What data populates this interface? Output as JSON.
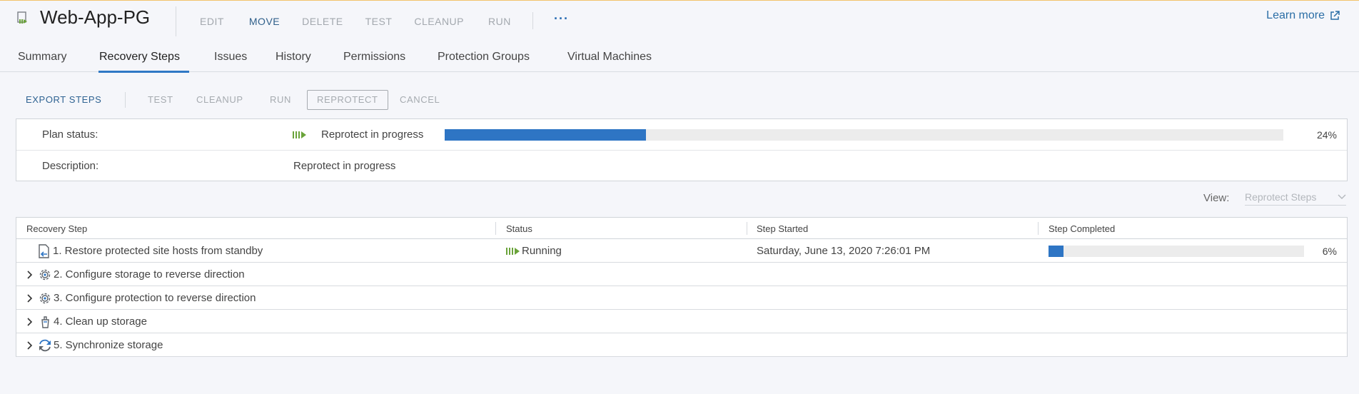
{
  "header": {
    "title": "Web-App-PG",
    "actions": [
      "EDIT",
      "MOVE",
      "DELETE",
      "TEST",
      "CLEANUP",
      "RUN"
    ],
    "more": "···",
    "learn_more": "Learn more"
  },
  "tabs": [
    "Summary",
    "Recovery Steps",
    "Issues",
    "History",
    "Permissions",
    "Protection Groups",
    "Virtual Machines"
  ],
  "toolbar": {
    "export": "EXPORT STEPS",
    "test": "TEST",
    "cleanup": "CLEANUP",
    "run": "RUN",
    "reprotect": "REPROTECT",
    "cancel": "CANCEL"
  },
  "plan": {
    "status_label": "Plan status:",
    "status_value": "Reprotect in progress",
    "progress_percent": 24,
    "progress_text": "24%",
    "description_label": "Description:",
    "description_value": "Reprotect in progress"
  },
  "view": {
    "label": "View:",
    "selected": "Reprotect Steps"
  },
  "table": {
    "columns": [
      "Recovery Step",
      "Status",
      "Step Started",
      "Step Completed"
    ],
    "rows": [
      {
        "step": "1. Restore protected site hosts from standby",
        "status": "Running",
        "started": "Saturday, June 13, 2020 7:26:01 PM",
        "completed_percent": 6,
        "completed_text": "6%"
      },
      {
        "step": "2. Configure storage to reverse direction"
      },
      {
        "step": "3. Configure protection to reverse direction"
      },
      {
        "step": "4. Clean up storage"
      },
      {
        "step": "5. Synchronize storage"
      }
    ]
  },
  "colors": {
    "accent": "#2e75c4",
    "running": "#6aa33a"
  }
}
